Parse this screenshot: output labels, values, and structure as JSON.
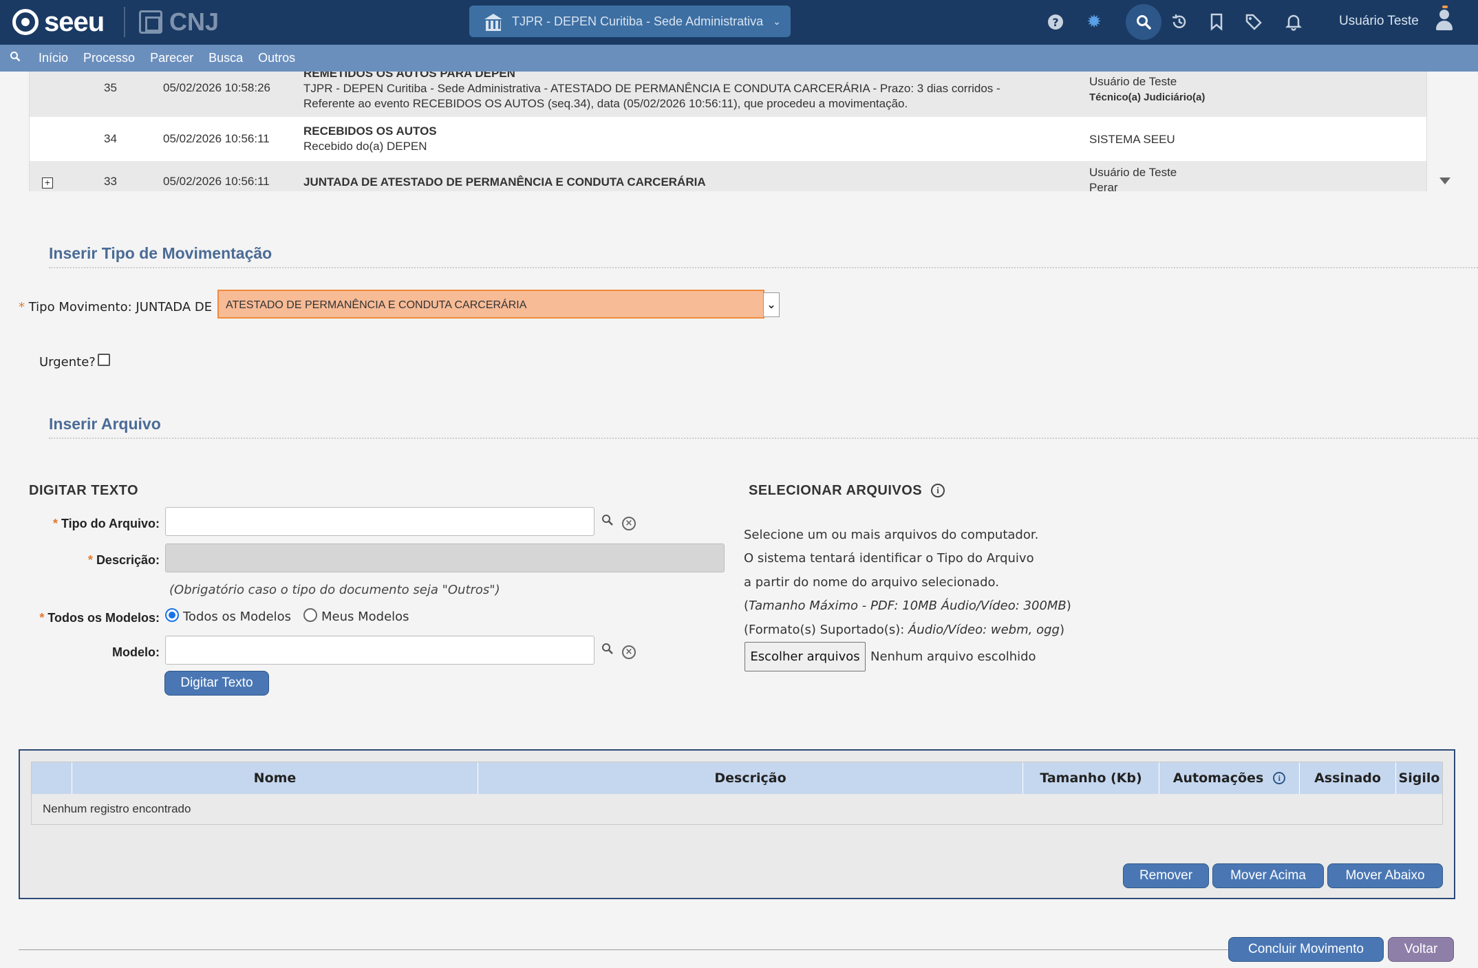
{
  "header": {
    "logo_text": "seeu",
    "cnj_text": "CNJ",
    "unit": "TJPR - DEPEN Curitiba - Sede Administrativa",
    "user_name": "Usuário Teste",
    "icons": [
      "help-icon",
      "bug-icon",
      "search-icon",
      "history-icon",
      "bookmark-icon",
      "tag-icon",
      "bell-icon",
      "avatar-icon"
    ]
  },
  "menu": {
    "items": [
      "Início",
      "Processo",
      "Parecer",
      "Busca",
      "Outros"
    ]
  },
  "movements": [
    {
      "seq": "35",
      "datetime": "05/02/2026 10:58:26",
      "title": "REMETIDOS OS AUTOS PARA DEPEN",
      "line1": "TJPR - DEPEN Curitiba - Sede Administrativa - ATESTADO DE PERMANÊNCIA E CONDUTA CARCERÁRIA - Prazo: 3 dias corridos -",
      "line2": "Referente ao evento RECEBIDOS OS AUTOS (seq.34), data (05/02/2026 10:56:11), que procedeu a movimentação.",
      "user": "Usuário de Teste",
      "role": "Técnico(a) Judiciário(a)"
    },
    {
      "seq": "34",
      "datetime": "05/02/2026 10:56:11",
      "title": "RECEBIDOS OS AUTOS",
      "line1": "Recebido do(a) DEPEN",
      "user": "SISTEMA SEEU"
    },
    {
      "seq": "33",
      "datetime": "05/02/2026 10:56:11",
      "title": "JUNTADA DE ATESTADO DE PERMANÊNCIA E CONDUTA CARCERÁRIA",
      "user": "Usuário de Teste",
      "role": "Perar"
    }
  ],
  "section_tipo": {
    "title": "Inserir Tipo de Movimentação",
    "label": "Tipo Movimento:",
    "prefix": "JUNTADA DE",
    "selected": "ATESTADO DE PERMANÊNCIA E CONDUTA CARCERÁRIA",
    "urgent_label": "Urgente?"
  },
  "section_arquivo": {
    "title": "Inserir Arquivo"
  },
  "digitar": {
    "title": "DIGITAR TEXTO",
    "tipo_label": "Tipo do Arquivo:",
    "descricao_label": "Descrição:",
    "hint": "(Obrigatório caso o tipo do documento seja \"Outros\")",
    "modelos_label": "Todos os Modelos:",
    "radio_all": "Todos os Modelos",
    "radio_mine": "Meus Modelos",
    "modelo_label": "Modelo:",
    "button": "Digitar Texto"
  },
  "selecionar": {
    "title": "SELECIONAR ARQUIVOS",
    "line1": "Selecione um ou mais arquivos do computador.",
    "line2": "O sistema tentará identificar o Tipo do Arquivo",
    "line3": "a partir do nome do arquivo selecionado.",
    "line4_pre": "(",
    "line4_it": "Tamanho Máximo - PDF: 10MB  Áudio/Vídeo: 300MB",
    "line4_post": ")",
    "line5_pre": "(Formato(s) Suportado(s): ",
    "line5_it": "Áudio/Vídeo: webm, ogg",
    "line5_post": ")",
    "file_button": "Escolher arquivos",
    "file_none": "Nenhum arquivo escolhido"
  },
  "files_table": {
    "columns": [
      "Nome",
      "Descrição",
      "Tamanho (Kb)",
      "Automações",
      "Assinado",
      "Sigilo"
    ],
    "empty": "Nenhum registro encontrado",
    "remove": "Remover",
    "move_up": "Mover Acima",
    "move_down": "Mover Abaixo"
  },
  "footer": {
    "conclude": "Concluir Movimento",
    "back": "Voltar"
  }
}
